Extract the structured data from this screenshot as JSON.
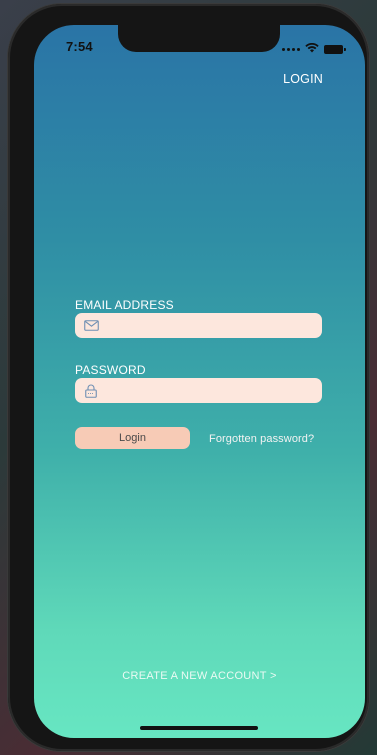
{
  "status_bar": {
    "time": "7:54",
    "icons": [
      "signal-dots-icon",
      "wifi-icon",
      "battery-icon"
    ]
  },
  "header": {
    "login_label": "LOGIN"
  },
  "form": {
    "email": {
      "label": "EMAIL ADDRESS",
      "value": "",
      "placeholder": "",
      "icon": "envelope-icon"
    },
    "password": {
      "label": "PASSWORD",
      "value": "",
      "placeholder": "",
      "icon": "lock-icon"
    },
    "login_button_label": "Login",
    "forgot_password_label": "Forgotten password?"
  },
  "footer": {
    "create_account_label": "CREATE A NEW ACCOUNT >"
  },
  "colors": {
    "gradient_top": "#2a74a6",
    "gradient_bottom": "#67e6c2",
    "input_background": "#fde7dd",
    "button_background": "#f7cbb6",
    "icon_color": "#6f8fb3"
  }
}
